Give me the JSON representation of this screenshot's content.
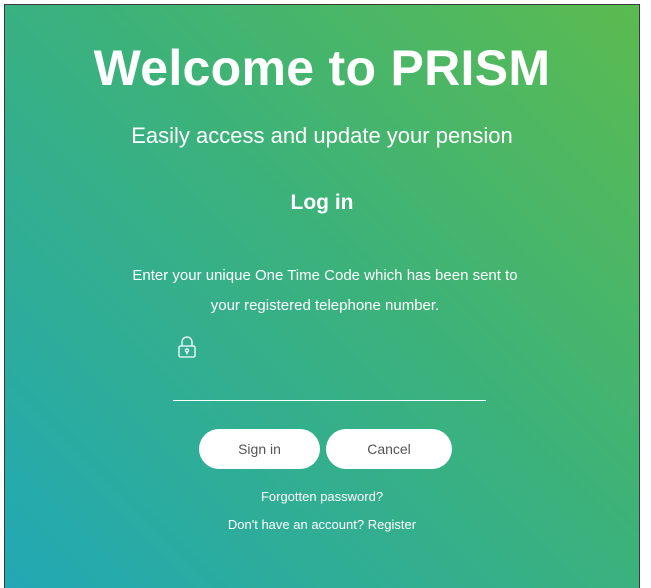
{
  "header": {
    "title": "Welcome to PRISM",
    "subtitle": "Easily access and update your pension"
  },
  "login": {
    "heading": "Log in",
    "instruction": "Enter your unique One Time Code which has been sent to your registered telephone number.",
    "otc_input": {
      "value": "",
      "placeholder": ""
    },
    "sign_in_label": "Sign in",
    "cancel_label": "Cancel",
    "forgot_password_label": "Forgotten password?",
    "register_label": "Don't have an account? Register"
  },
  "icons": {
    "lock": "lock-icon"
  },
  "colors": {
    "gradient_top_right": "#5bbb4f",
    "gradient_middle": "#3cb27a",
    "gradient_bottom_left": "#22a8b5",
    "text": "#ffffff",
    "button_bg": "#ffffff",
    "button_text": "#555555"
  }
}
